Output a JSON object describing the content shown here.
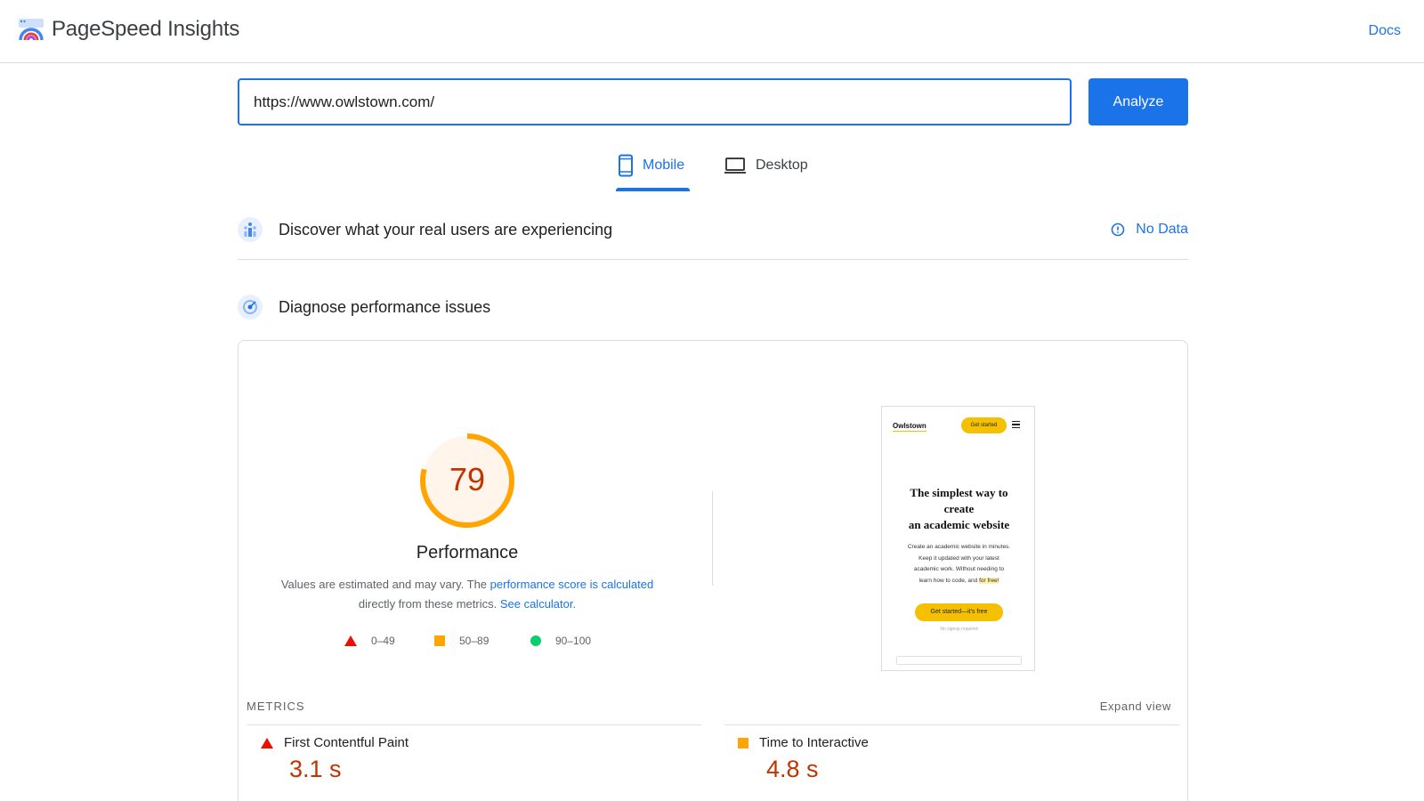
{
  "app": {
    "title": "PageSpeed Insights",
    "docs_label": "Docs"
  },
  "search": {
    "url_value": "https://www.owlstown.com/",
    "analyze_label": "Analyze"
  },
  "tabs": [
    {
      "label": "Mobile",
      "active": true,
      "icon": "smartphone-icon"
    },
    {
      "label": "Desktop",
      "active": false,
      "icon": "laptop-icon"
    }
  ],
  "cwv_section": {
    "title": "Discover what your real users are experiencing",
    "status": "No Data",
    "icon": "users-chart-icon"
  },
  "diagnose_section": {
    "title": "Diagnose performance issues",
    "icon": "gauge-target-icon"
  },
  "score": {
    "value": "79",
    "fraction": 0.79,
    "label": "Performance",
    "color": "#ffa400",
    "desc_prefix": "Values are estimated and may vary. The ",
    "desc_link1": "performance score is calculated",
    "desc_mid": "directly from these metrics. ",
    "desc_link2": "See calculator."
  },
  "legend": [
    {
      "range": "0–49",
      "shape": "triangle",
      "color": "#eb0f00"
    },
    {
      "range": "50–89",
      "shape": "square",
      "color": "#ffa400"
    },
    {
      "range": "90–100",
      "shape": "circle",
      "color": "#0cce6b"
    }
  ],
  "screenshot": {
    "brand": "Owlstown",
    "top_cta": "Get started",
    "headline_1": "The simplest way to",
    "headline_2": "create",
    "headline_3": "an academic website",
    "body_1": "Create an academic website in minutes.",
    "body_2": "Keep it updated with your latest",
    "body_3": "academic work. Without needing to",
    "body_4": "learn how to code, and ",
    "body_highlight": "for free!",
    "cta": "Get started—it's free",
    "note": "No signup required"
  },
  "metrics": {
    "section_label": "METRICS",
    "expand_label": "Expand view",
    "items": [
      {
        "name": "First Contentful Paint",
        "value": "3.1 s",
        "rating": "fail"
      },
      {
        "name": "Time to Interactive",
        "value": "4.8 s",
        "rating": "average"
      }
    ]
  },
  "colors": {
    "accent": "#1a73e8",
    "fail": "#eb0f00",
    "average": "#ffa400",
    "pass": "#0cce6b",
    "fail_text": "#c33300"
  }
}
